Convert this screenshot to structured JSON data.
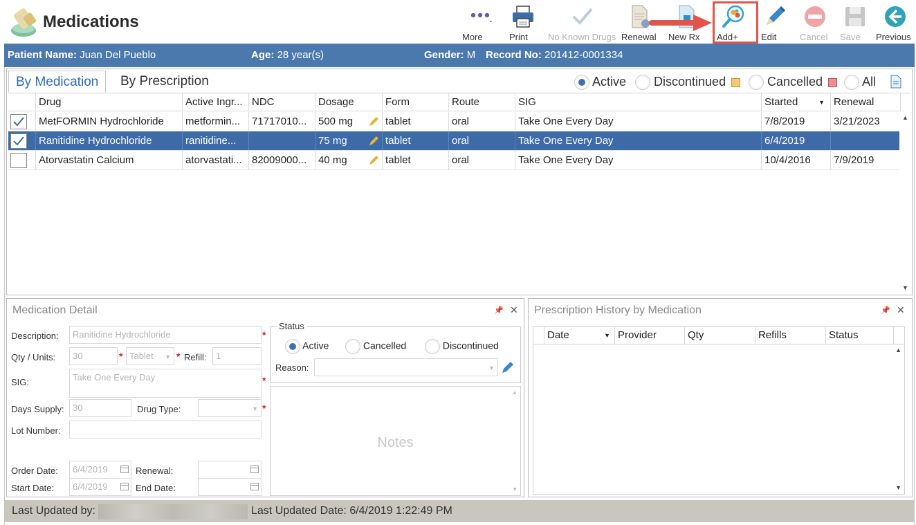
{
  "app": {
    "title": "Medications"
  },
  "toolbar": {
    "more": "More",
    "print": "Print",
    "no_known_drugs": "No Known Drugs",
    "renewal": "Renewal",
    "new_rx": "New Rx",
    "add": "Add+",
    "edit": "Edit",
    "cancel": "Cancel",
    "save": "Save",
    "previous": "Previous"
  },
  "patient": {
    "name_label": "Patient Name:",
    "name": "Juan Del Pueblo",
    "age_label": "Age:",
    "age": "28 year(s)",
    "gender_label": "Gender:",
    "gender": "M",
    "record_label": "Record No:",
    "record": "201412-0001334"
  },
  "tabs": {
    "by_medication": "By Medication",
    "by_prescription": "By Prescription"
  },
  "filters": {
    "active": "Active",
    "discontinued": "Discontinued",
    "cancelled": "Cancelled",
    "all": "All",
    "selected": "active",
    "discontinued_color": "#f5c97a",
    "cancelled_color": "#ec8e90"
  },
  "grid": {
    "columns": [
      "Drug",
      "Active Ingr...",
      "NDC",
      "Dosage",
      "Form",
      "Route",
      "SIG",
      "Started",
      "Renewal"
    ],
    "rows": [
      {
        "checked": true,
        "selected": false,
        "drug": "MetFORMIN Hydrochloride",
        "ingredient": "metformin...",
        "ndc": "71717010...",
        "dosage": "500 mg",
        "form": "tablet",
        "route": "oral",
        "sig": "Take One Every Day",
        "started": "7/8/2019",
        "renewal": "3/21/2023"
      },
      {
        "checked": true,
        "selected": true,
        "drug": "Ranitidine Hydrochloride",
        "ingredient": "ranitidine...",
        "ndc": "",
        "dosage": "75 mg",
        "form": "tablet",
        "route": "oral",
        "sig": "Take One Every Day",
        "started": "6/4/2019",
        "renewal": ""
      },
      {
        "checked": false,
        "selected": false,
        "drug": "Atorvastatin Calcium",
        "ingredient": "atorvastati...",
        "ndc": "82009000...",
        "dosage": "40 mg",
        "form": "tablet",
        "route": "oral",
        "sig": "Take One Every Day",
        "started": "10/4/2016",
        "renewal": "7/9/2019"
      }
    ]
  },
  "detail": {
    "title": "Medication Detail",
    "description_label": "Description:",
    "description": "Ranitidine Hydrochloride",
    "qty_label": "Qty / Units:",
    "qty": "30",
    "units": "Tablet",
    "refill_label": "Refill:",
    "refill": "1",
    "sig_label": "SIG:",
    "sig": "Take One Every Day",
    "days_supply_label": "Days Supply:",
    "days_supply": "30",
    "drug_type_label": "Drug Type:",
    "drug_type": "",
    "lot_label": "Lot Number:",
    "lot": "",
    "order_date_label": "Order Date:",
    "order_date": "6/4/2019",
    "renewal_label": "Renewal:",
    "renewal": "",
    "start_date_label": "Start Date:",
    "start_date": "6/4/2019",
    "end_date_label": "End Date:",
    "end_date": "",
    "status_label": "Status",
    "status_active": "Active",
    "status_cancelled": "Cancelled",
    "status_discontinued": "Discontinued",
    "reason_label": "Reason:",
    "notes_placeholder": "Notes"
  },
  "history": {
    "title": "Prescription History by Medication",
    "columns": [
      "Date",
      "Provider",
      "Qty",
      "Refills",
      "Status"
    ]
  },
  "status": {
    "last_updated_by_label": "Last Updated by:",
    "last_updated_date": "Last Updated Date: 6/4/2019 1:22:49 PM"
  }
}
